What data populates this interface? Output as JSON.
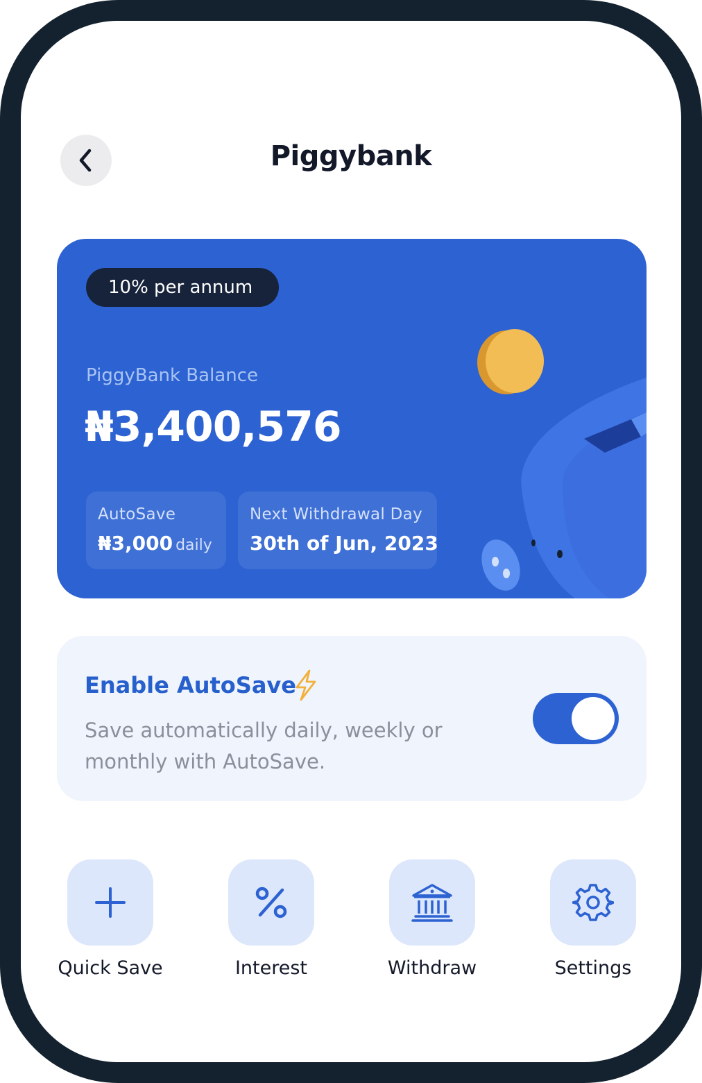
{
  "header": {
    "title": "Piggybank"
  },
  "card": {
    "rate_badge": "10% per annum",
    "balance_label": "PiggyBank Balance",
    "balance_value": "₦3,400,576",
    "autosave": {
      "label": "AutoSave",
      "amount": "₦3,000",
      "frequency": "daily"
    },
    "next_withdrawal": {
      "label": "Next Withdrawal Day",
      "date": "30th of Jun, 2023"
    }
  },
  "autosave_settings": {
    "title": "Enable AutoSave",
    "description": "Save automatically daily, weekly or monthly with AutoSave.",
    "enabled": true
  },
  "actions": [
    {
      "label": "Quick Save",
      "icon": "plus-icon"
    },
    {
      "label": "Interest",
      "icon": "percent-icon"
    },
    {
      "label": "Withdraw",
      "icon": "bank-icon"
    },
    {
      "label": "Settings",
      "icon": "gear-icon"
    }
  ],
  "colors": {
    "accent": "#2d62d2",
    "frame": "#14222f",
    "badge": "#17233b",
    "coin": "#f2bd55"
  }
}
